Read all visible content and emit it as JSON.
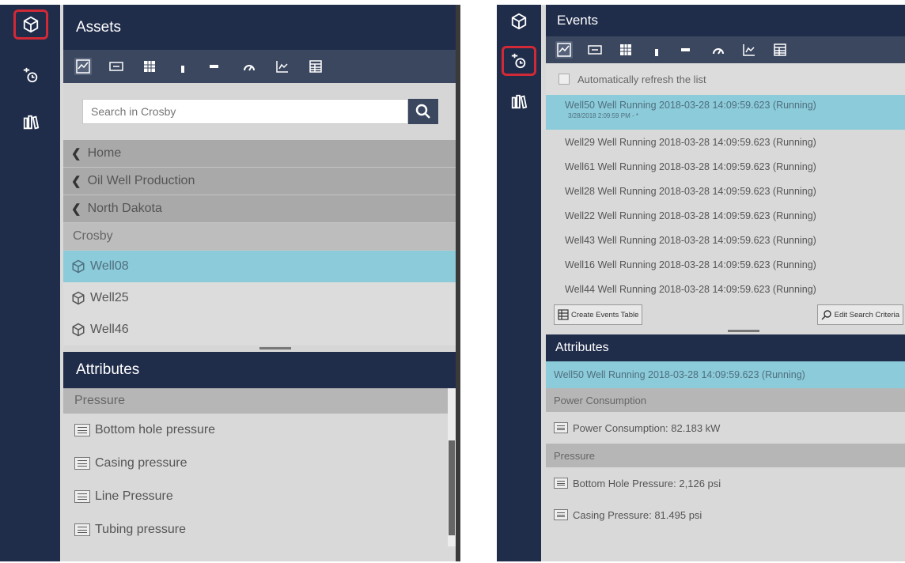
{
  "assets_panel": {
    "title": "Assets",
    "search_placeholder": "Search in Crosby",
    "breadcrumbs": [
      "Home",
      "Oil Well Production",
      "North Dakota"
    ],
    "current_location": "Crosby",
    "assets": [
      {
        "label": "Well08",
        "selected": true
      },
      {
        "label": "Well25",
        "selected": false
      },
      {
        "label": "Well46",
        "selected": false
      }
    ],
    "attributes_title": "Attributes",
    "attribute_group": "Pressure",
    "attributes": [
      "Bottom hole pressure",
      "Casing pressure",
      "Line Pressure",
      "Tubing pressure"
    ]
  },
  "events_panel": {
    "title": "Events",
    "auto_refresh_label": "Automatically refresh the list",
    "events": [
      {
        "label": "Well50 Well Running 2018-03-28 14:09:59.623 (Running)",
        "sub": "3/28/2018 2:09:59 PM - *",
        "selected": true
      },
      {
        "label": "Well29 Well Running 2018-03-28 14:09:59.623 (Running)"
      },
      {
        "label": "Well61 Well Running 2018-03-28 14:09:59.623 (Running)"
      },
      {
        "label": "Well28 Well Running 2018-03-28 14:09:59.623 (Running)"
      },
      {
        "label": "Well22 Well Running 2018-03-28 14:09:59.623 (Running)"
      },
      {
        "label": "Well43 Well Running 2018-03-28 14:09:59.623 (Running)"
      },
      {
        "label": "Well16 Well Running 2018-03-28 14:09:59.623 (Running)"
      },
      {
        "label": "Well44 Well Running 2018-03-28 14:09:59.623 (Running)"
      }
    ],
    "create_table_label": "Create Events Table",
    "edit_search_label": "Edit Search Criteria",
    "attributes_title": "Attributes",
    "selected_event": "Well50 Well Running 2018-03-28 14:09:59.623 (Running)",
    "groups": [
      {
        "name": "Power Consumption",
        "items": [
          "Power Consumption: 82.183 kW"
        ]
      },
      {
        "name": "Pressure",
        "items": [
          "Bottom Hole Pressure: 2,126 psi",
          "Casing Pressure: 81.495 psi"
        ]
      }
    ]
  },
  "toolbar_icons": [
    "trend-icon",
    "value-icon",
    "table-icon",
    "vertical-gauge-icon",
    "horizontal-gauge-icon",
    "radial-gauge-icon",
    "xy-plot-icon",
    "asset-comparison-table-icon"
  ],
  "rail_icons": [
    "assets-icon",
    "events-icon",
    "library-icon"
  ],
  "colors": {
    "nav_dark": "#1f2c4a",
    "toolbar": "#3a475f",
    "selection": "#8ccbd9",
    "active_outline": "#d12a36",
    "panel_bg": "#d9d9d9"
  }
}
